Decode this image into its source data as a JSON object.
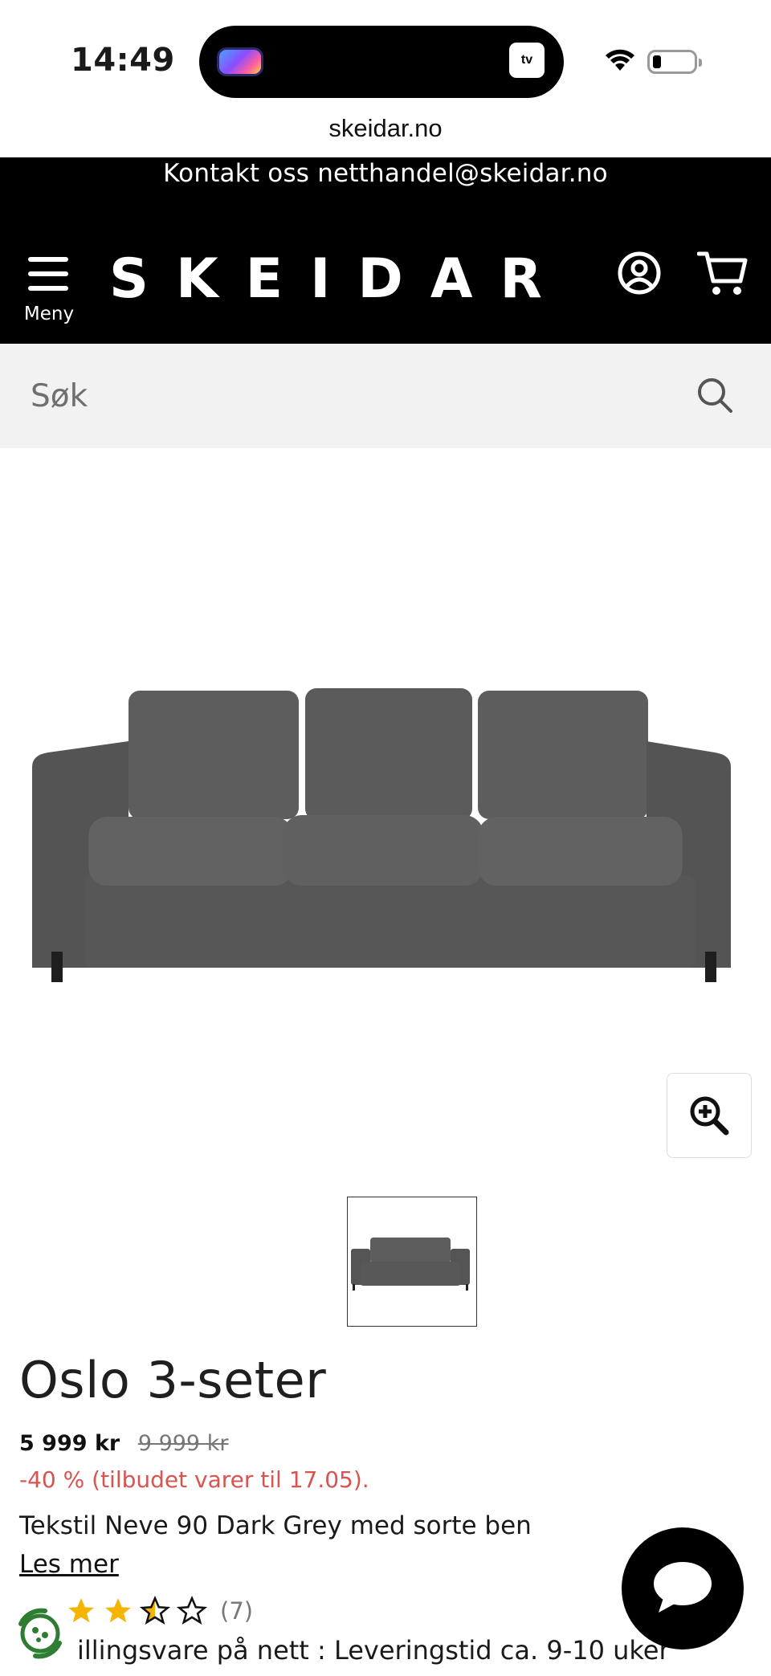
{
  "status_bar": {
    "time": "14:49",
    "island_tv_label": "tv"
  },
  "browser": {
    "url": "skeidar.no"
  },
  "header": {
    "contact_text": "Kontakt oss netthandel@skeidar.no",
    "menu_label": "Meny",
    "logo": "SKEIDAR",
    "colors": {
      "header_bg": "#000000",
      "header_fg": "#ffffff"
    }
  },
  "search": {
    "placeholder": "Søk"
  },
  "product": {
    "title": "Oslo 3-seter",
    "price_current": "5 999 kr",
    "price_old": "9 999 kr",
    "discount_text": "-40 % (tilbudet varer til 17.05).",
    "variant_text": "Tekstil Neve 90 Dark Grey med sorte ben",
    "read_more": "Les mer",
    "rating": {
      "stars": 2.5,
      "max": 5,
      "count_text": "(7)"
    },
    "delivery_text": "illingsvare på nett : Leveringstid ca. 9-10 uker",
    "colors": {
      "discount": "#d9534f",
      "star": "#f5b400"
    }
  },
  "icons": {
    "menu": "hamburger-icon",
    "account": "account-icon",
    "cart": "cart-icon",
    "search": "search-icon",
    "zoom": "zoom-in-icon",
    "chat": "chat-icon",
    "eco": "eco-badge-icon"
  }
}
